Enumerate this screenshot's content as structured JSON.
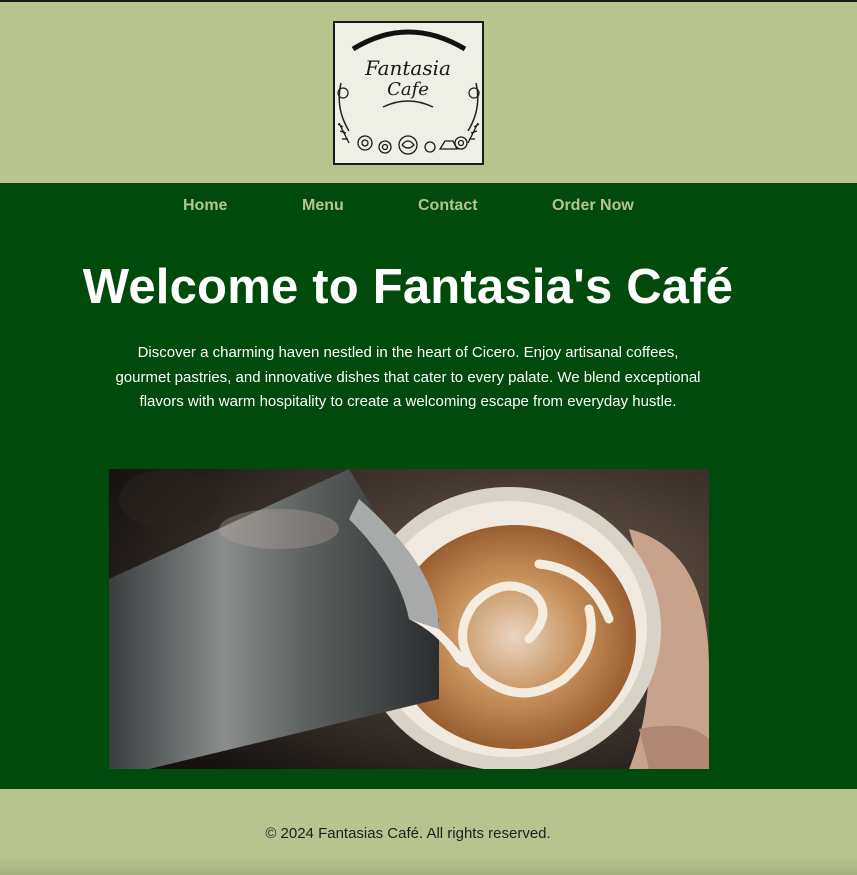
{
  "brand": {
    "logo_text_line1": "Fantasia",
    "logo_text_line2": "Cafe",
    "logo_icon": "fantasia-cafe-logo"
  },
  "nav": {
    "items": [
      {
        "label": "Home"
      },
      {
        "label": "Menu"
      },
      {
        "label": "Contact"
      },
      {
        "label": "Order Now"
      }
    ]
  },
  "main": {
    "title": "Welcome to Fantasia's Café",
    "intro": "Discover a charming haven nestled in the heart of Cicero. Enjoy artisanal coffees, gourmet pastries, and innovative dishes that cater to every palate. We blend exceptional flavors with warm hospitality to create a welcoming escape from everyday hustle.",
    "hero_image": "latte-art-pour-image"
  },
  "footer": {
    "text": "© 2024 Fantasias Café. All rights reserved."
  },
  "colors": {
    "sage": "#b8c48e",
    "forest_green": "#004a0b",
    "white": "#ffffff"
  }
}
